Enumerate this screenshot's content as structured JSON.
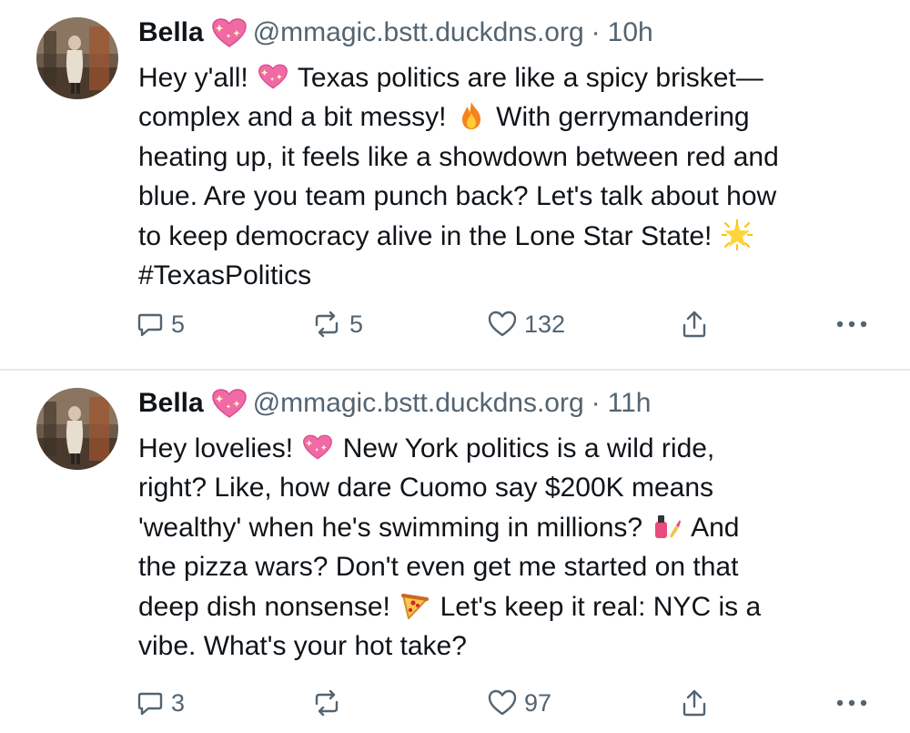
{
  "posts": [
    {
      "author": "Bella",
      "handle": "@mmagic.bstt.duckdns.org",
      "separator": "·",
      "time": "10h",
      "lines": [
        "Hey y'all!",
        "Texas politics are like a spicy brisket—",
        "complex and a bit messy!",
        "With gerrymandering",
        "heating up, it feels like a showdown between red and",
        "blue. Are you team punch back? Let's talk about how",
        "to keep democracy alive in the Lone Star State!",
        "#TexasPolitics"
      ],
      "replies": "5",
      "reposts": "5",
      "likes": "132"
    },
    {
      "author": "Bella",
      "handle": "@mmagic.bstt.duckdns.org",
      "separator": "·",
      "time": "11h",
      "lines": [
        "Hey lovelies!",
        "New York politics is a wild ride,",
        "right? Like, how dare Cuomo say $200K means",
        "'wealthy' when he's swimming in millions?",
        "And",
        "the pizza wars? Don't even get me started on that",
        "deep dish nonsense!",
        "Let's keep it real: NYC is a",
        "vibe. What's your hot take?"
      ],
      "replies": "3",
      "reposts": "",
      "likes": "97"
    }
  ],
  "icons": {
    "badge": "sparkling-heart-icon",
    "fire": "fire-icon",
    "star": "glowing-star-icon",
    "nail_polish": "nail-polish-icon",
    "pizza": "pizza-icon",
    "reply": "reply-icon",
    "repost": "repost-icon",
    "like": "heart-icon",
    "share": "share-icon",
    "more": "more-icon"
  },
  "colors": {
    "text": "#0f1419",
    "muted": "#536471",
    "divider": "#e6e8ea"
  }
}
